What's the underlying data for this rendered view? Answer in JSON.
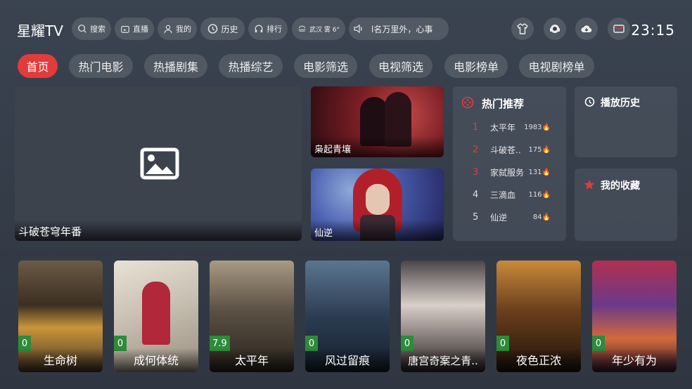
{
  "app": {
    "title": "星耀TV",
    "clock": "23:15"
  },
  "topbar": {
    "search": "搜索",
    "live": "直播",
    "mine": "我的",
    "history": "历史",
    "rank": "排行",
    "weather": "武汉 雾 6°",
    "marquee": "l名万里外，心事"
  },
  "nav": {
    "tabs": [
      {
        "label": "首页",
        "active": true
      },
      {
        "label": "热门电影"
      },
      {
        "label": "热播剧集"
      },
      {
        "label": "热播综艺"
      },
      {
        "label": "电影筛选"
      },
      {
        "label": "电视筛选"
      },
      {
        "label": "电影榜单"
      },
      {
        "label": "电视剧榜单"
      }
    ]
  },
  "featured": {
    "main": "斗破苍穹年番",
    "side1": "枭起青壤",
    "side2": "仙逆"
  },
  "hot": {
    "title": "热门推荐",
    "items": [
      {
        "rank": "1",
        "name": "太平年",
        "count": "1983🔥"
      },
      {
        "rank": "2",
        "name": "斗破苍..",
        "count": "175🔥"
      },
      {
        "rank": "3",
        "name": "家弑服务",
        "count": "131🔥"
      },
      {
        "rank": "4",
        "name": "三滴血",
        "count": "116🔥"
      },
      {
        "rank": "5",
        "name": "仙逆",
        "count": "84🔥"
      }
    ]
  },
  "history_panel": {
    "title": "播放历史"
  },
  "favorites_panel": {
    "title": "我的收藏"
  },
  "posters": [
    {
      "title": "生命树",
      "score": "0"
    },
    {
      "title": "成何体统",
      "score": "0"
    },
    {
      "title": "太平年",
      "score": "7.9"
    },
    {
      "title": "风过留痕",
      "score": "0"
    },
    {
      "title": "唐宫奇案之青..",
      "score": "0"
    },
    {
      "title": "夜色正浓",
      "score": "0"
    },
    {
      "title": "年少有为",
      "score": "0"
    }
  ],
  "colors": {
    "accent": "#e23b3b",
    "score_bg": "#2e8b3a"
  }
}
